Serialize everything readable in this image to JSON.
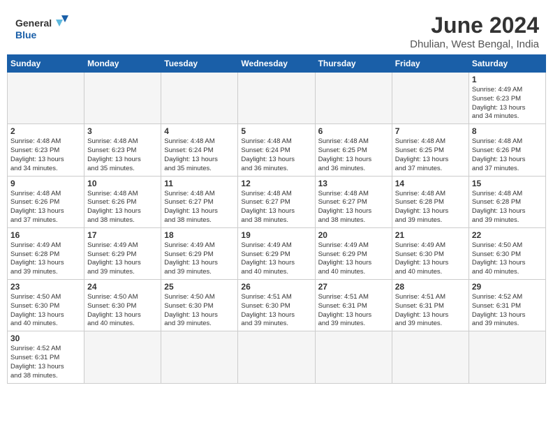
{
  "logo": {
    "general": "General",
    "blue": "Blue"
  },
  "title": {
    "month_year": "June 2024",
    "location": "Dhulian, West Bengal, India"
  },
  "weekdays": [
    "Sunday",
    "Monday",
    "Tuesday",
    "Wednesday",
    "Thursday",
    "Friday",
    "Saturday"
  ],
  "weeks": [
    [
      {
        "day": "",
        "info": ""
      },
      {
        "day": "",
        "info": ""
      },
      {
        "day": "",
        "info": ""
      },
      {
        "day": "",
        "info": ""
      },
      {
        "day": "",
        "info": ""
      },
      {
        "day": "",
        "info": ""
      },
      {
        "day": "1",
        "info": "Sunrise: 4:49 AM\nSunset: 6:23 PM\nDaylight: 13 hours\nand 34 minutes."
      }
    ],
    [
      {
        "day": "2",
        "info": "Sunrise: 4:48 AM\nSunset: 6:23 PM\nDaylight: 13 hours\nand 34 minutes."
      },
      {
        "day": "3",
        "info": "Sunrise: 4:48 AM\nSunset: 6:23 PM\nDaylight: 13 hours\nand 35 minutes."
      },
      {
        "day": "4",
        "info": "Sunrise: 4:48 AM\nSunset: 6:24 PM\nDaylight: 13 hours\nand 35 minutes."
      },
      {
        "day": "5",
        "info": "Sunrise: 4:48 AM\nSunset: 6:24 PM\nDaylight: 13 hours\nand 36 minutes."
      },
      {
        "day": "6",
        "info": "Sunrise: 4:48 AM\nSunset: 6:25 PM\nDaylight: 13 hours\nand 36 minutes."
      },
      {
        "day": "7",
        "info": "Sunrise: 4:48 AM\nSunset: 6:25 PM\nDaylight: 13 hours\nand 37 minutes."
      },
      {
        "day": "8",
        "info": "Sunrise: 4:48 AM\nSunset: 6:26 PM\nDaylight: 13 hours\nand 37 minutes."
      }
    ],
    [
      {
        "day": "9",
        "info": "Sunrise: 4:48 AM\nSunset: 6:26 PM\nDaylight: 13 hours\nand 37 minutes."
      },
      {
        "day": "10",
        "info": "Sunrise: 4:48 AM\nSunset: 6:26 PM\nDaylight: 13 hours\nand 38 minutes."
      },
      {
        "day": "11",
        "info": "Sunrise: 4:48 AM\nSunset: 6:27 PM\nDaylight: 13 hours\nand 38 minutes."
      },
      {
        "day": "12",
        "info": "Sunrise: 4:48 AM\nSunset: 6:27 PM\nDaylight: 13 hours\nand 38 minutes."
      },
      {
        "day": "13",
        "info": "Sunrise: 4:48 AM\nSunset: 6:27 PM\nDaylight: 13 hours\nand 38 minutes."
      },
      {
        "day": "14",
        "info": "Sunrise: 4:48 AM\nSunset: 6:28 PM\nDaylight: 13 hours\nand 39 minutes."
      },
      {
        "day": "15",
        "info": "Sunrise: 4:48 AM\nSunset: 6:28 PM\nDaylight: 13 hours\nand 39 minutes."
      }
    ],
    [
      {
        "day": "16",
        "info": "Sunrise: 4:49 AM\nSunset: 6:28 PM\nDaylight: 13 hours\nand 39 minutes."
      },
      {
        "day": "17",
        "info": "Sunrise: 4:49 AM\nSunset: 6:29 PM\nDaylight: 13 hours\nand 39 minutes."
      },
      {
        "day": "18",
        "info": "Sunrise: 4:49 AM\nSunset: 6:29 PM\nDaylight: 13 hours\nand 39 minutes."
      },
      {
        "day": "19",
        "info": "Sunrise: 4:49 AM\nSunset: 6:29 PM\nDaylight: 13 hours\nand 40 minutes."
      },
      {
        "day": "20",
        "info": "Sunrise: 4:49 AM\nSunset: 6:29 PM\nDaylight: 13 hours\nand 40 minutes."
      },
      {
        "day": "21",
        "info": "Sunrise: 4:49 AM\nSunset: 6:30 PM\nDaylight: 13 hours\nand 40 minutes."
      },
      {
        "day": "22",
        "info": "Sunrise: 4:50 AM\nSunset: 6:30 PM\nDaylight: 13 hours\nand 40 minutes."
      }
    ],
    [
      {
        "day": "23",
        "info": "Sunrise: 4:50 AM\nSunset: 6:30 PM\nDaylight: 13 hours\nand 40 minutes."
      },
      {
        "day": "24",
        "info": "Sunrise: 4:50 AM\nSunset: 6:30 PM\nDaylight: 13 hours\nand 40 minutes."
      },
      {
        "day": "25",
        "info": "Sunrise: 4:50 AM\nSunset: 6:30 PM\nDaylight: 13 hours\nand 39 minutes."
      },
      {
        "day": "26",
        "info": "Sunrise: 4:51 AM\nSunset: 6:30 PM\nDaylight: 13 hours\nand 39 minutes."
      },
      {
        "day": "27",
        "info": "Sunrise: 4:51 AM\nSunset: 6:31 PM\nDaylight: 13 hours\nand 39 minutes."
      },
      {
        "day": "28",
        "info": "Sunrise: 4:51 AM\nSunset: 6:31 PM\nDaylight: 13 hours\nand 39 minutes."
      },
      {
        "day": "29",
        "info": "Sunrise: 4:52 AM\nSunset: 6:31 PM\nDaylight: 13 hours\nand 39 minutes."
      }
    ],
    [
      {
        "day": "30",
        "info": "Sunrise: 4:52 AM\nSunset: 6:31 PM\nDaylight: 13 hours\nand 38 minutes."
      },
      {
        "day": "",
        "info": ""
      },
      {
        "day": "",
        "info": ""
      },
      {
        "day": "",
        "info": ""
      },
      {
        "day": "",
        "info": ""
      },
      {
        "day": "",
        "info": ""
      },
      {
        "day": "",
        "info": ""
      }
    ]
  ]
}
